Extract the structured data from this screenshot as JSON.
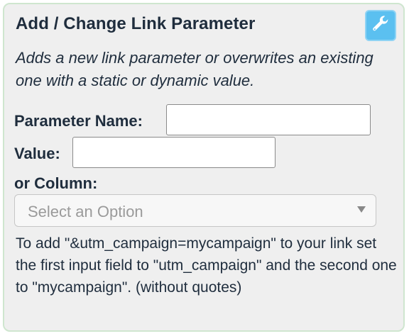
{
  "panel": {
    "title": "Add / Change Link Parameter",
    "settings_icon": "wrench-icon",
    "accent_color": "#5bc0f0",
    "description": "Adds a new link parameter or overwrites an existing one with a static or dynamic value."
  },
  "form": {
    "parameter_name_label": "Parameter Name:",
    "parameter_name_value": "",
    "value_label": "Value:",
    "value_value": "",
    "column_label": "or Column:",
    "column_select_placeholder": "Select an Option",
    "column_select_arrow_icon": "triangle-down-icon"
  },
  "help_text": "To add \"&utm_campaign=mycampaign\" to your link set the first input field to \"utm_campaign\" and the second one to \"mycampaign\". (without quotes)"
}
